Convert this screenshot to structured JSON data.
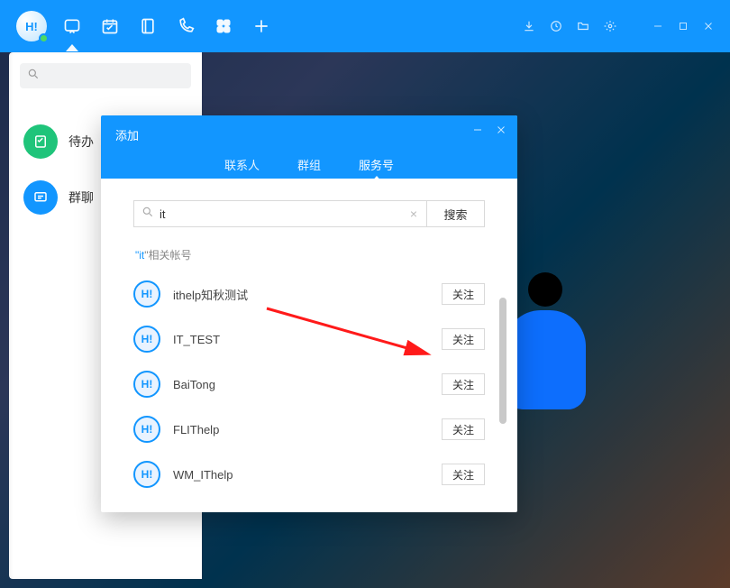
{
  "titlebar": {
    "avatar_text": "H!",
    "icons": [
      "chat-icon",
      "calendar-icon",
      "notebook-icon",
      "phone-icon",
      "apps-icon",
      "plus-icon"
    ],
    "right_icons": [
      "download-icon",
      "history-icon",
      "folder-icon",
      "settings-icon"
    ]
  },
  "sidebar": {
    "search_placeholder": "",
    "items": [
      {
        "label": "待办",
        "icon": "todo-icon"
      },
      {
        "label": "群聊",
        "icon": "groupchat-icon"
      }
    ]
  },
  "dialog": {
    "title": "添加",
    "tabs": [
      {
        "label": "联系人",
        "active": false
      },
      {
        "label": "群组",
        "active": false
      },
      {
        "label": "服务号",
        "active": true
      }
    ],
    "search": {
      "value": "it",
      "button": "搜索"
    },
    "hint_prefix": "\"",
    "hint_query": "it",
    "hint_suffix": "\"相关帐号",
    "follow_label": "关注",
    "results": [
      {
        "name": "ithelp知秋测试"
      },
      {
        "name": "IT_TEST"
      },
      {
        "name": "BaiTong"
      },
      {
        "name": "FLIThelp"
      },
      {
        "name": "WM_IThelp"
      }
    ]
  }
}
